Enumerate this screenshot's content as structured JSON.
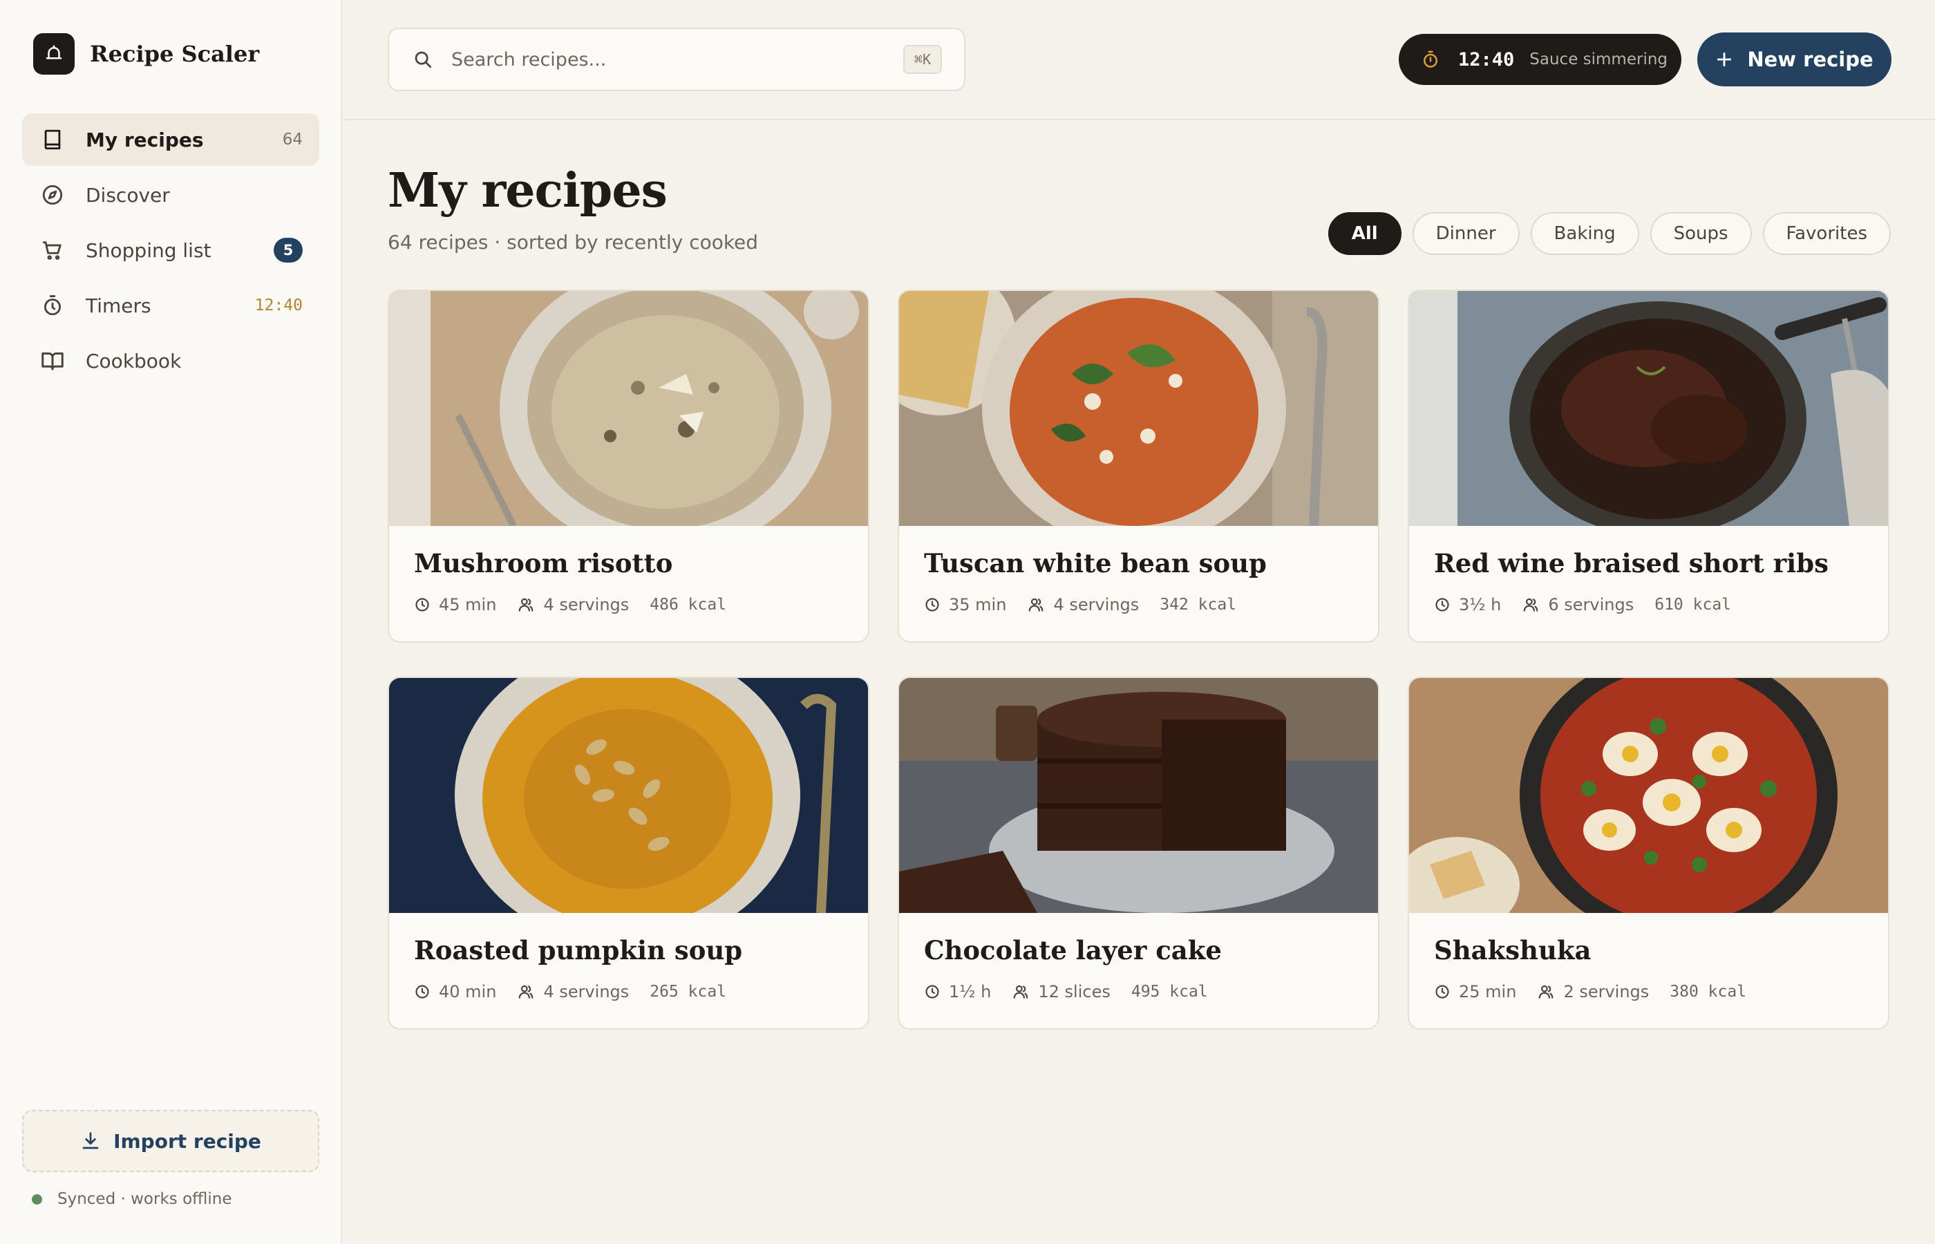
{
  "app": {
    "name": "Recipe Scaler"
  },
  "sidebar": {
    "items": [
      {
        "label": "My recipes",
        "count": "64",
        "icon": "book-icon",
        "active": true
      },
      {
        "label": "Discover",
        "icon": "compass-icon"
      },
      {
        "label": "Shopping list",
        "badge": "5",
        "icon": "cart-icon"
      },
      {
        "label": "Timers",
        "timer": "12:40",
        "icon": "stopwatch-icon"
      },
      {
        "label": "Cookbook",
        "icon": "open-book-icon"
      }
    ],
    "import_label": "Import recipe",
    "sync_status": "Synced · works offline"
  },
  "header": {
    "search_placeholder": "Search recipes...",
    "search_shortcut": "⌘K",
    "timer": {
      "time": "12:40",
      "label": "Sauce simmering"
    },
    "new_label": "New recipe"
  },
  "main": {
    "title": "My recipes",
    "subtitle": "64 recipes · sorted by recently cooked",
    "filters": [
      {
        "label": "All",
        "active": true
      },
      {
        "label": "Dinner"
      },
      {
        "label": "Baking"
      },
      {
        "label": "Soups"
      },
      {
        "label": "Favorites"
      }
    ],
    "recipes": [
      {
        "title": "Mushroom risotto",
        "time": "45 min",
        "servings": "4 servings",
        "kcal": "486  kcal"
      },
      {
        "title": "Tuscan white bean soup",
        "time": "35 min",
        "servings": "4 servings",
        "kcal": "342  kcal"
      },
      {
        "title": "Red wine braised short ribs",
        "time": "3½ h",
        "servings": "6 servings",
        "kcal": "610  kcal"
      },
      {
        "title": "Roasted pumpkin soup",
        "time": "40 min",
        "servings": "4 servings",
        "kcal": "265  kcal"
      },
      {
        "title": "Chocolate layer cake",
        "time": "1½ h",
        "servings": "12 slices",
        "kcal": "495  kcal"
      },
      {
        "title": "Shakshuka",
        "time": "25 min",
        "servings": "2 servings",
        "kcal": "380  kcal"
      }
    ]
  },
  "colors": {
    "accent": "#24415f",
    "dark": "#1f1b18",
    "background": "#f5f1eb",
    "timer": "#b5842f",
    "sync": "#5e8c5e"
  }
}
